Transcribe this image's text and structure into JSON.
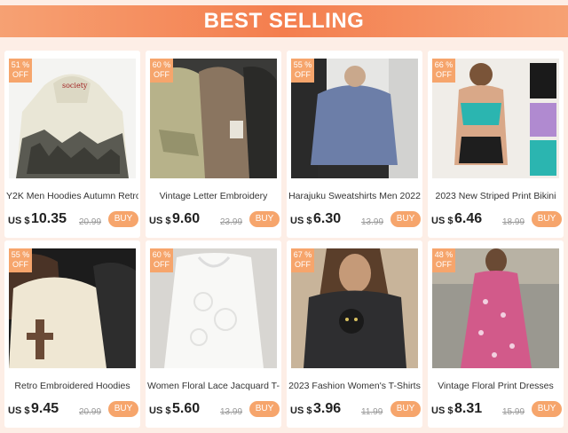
{
  "header": {
    "title": "BEST SELLING"
  },
  "colors": {
    "accent": "#f6a56c",
    "banner": "#f47e4e",
    "background": "#fdeee6"
  },
  "products": [
    {
      "discount": "51 %",
      "off": "OFF",
      "title": "Y2K  Men  Hoodies  Autumn Retro",
      "currency": "US $",
      "price": "10.35",
      "original": "20.99",
      "buy": "BUY"
    },
    {
      "discount": "60 %",
      "off": "OFF",
      "title": "Vintage Letter  Embroidery",
      "currency": "US $",
      "price": "9.60",
      "original": "23.99",
      "buy": "BUY"
    },
    {
      "discount": "55 %",
      "off": "OFF",
      "title": "Harajuku Sweatshirts Men 2022",
      "currency": "US $",
      "price": "6.30",
      "original": "13.99",
      "buy": "BUY"
    },
    {
      "discount": "66 %",
      "off": "OFF",
      "title": "2023 New Striped Print Bikini",
      "currency": "US $",
      "price": "6.46",
      "original": "18.99",
      "buy": "BUY"
    },
    {
      "discount": "55 %",
      "off": "OFF",
      "title": "Retro  Embroidered Hoodies",
      "currency": "US $",
      "price": "9.45",
      "original": "20.99",
      "buy": "BUY"
    },
    {
      "discount": "60 %",
      "off": "OFF",
      "title": "Women Floral Lace  Jacquard T-",
      "currency": "US $",
      "price": "5.60",
      "original": "13.99",
      "buy": "BUY"
    },
    {
      "discount": "67 %",
      "off": "OFF",
      "title": "2023 Fashion  Women's T-Shirts",
      "currency": "US $",
      "price": "3.96",
      "original": "11.99",
      "buy": "BUY"
    },
    {
      "discount": "48 %",
      "off": "OFF",
      "title": "Vintage Floral Print Dresses",
      "currency": "US $",
      "price": "8.31",
      "original": "15.99",
      "buy": "BUY"
    }
  ]
}
